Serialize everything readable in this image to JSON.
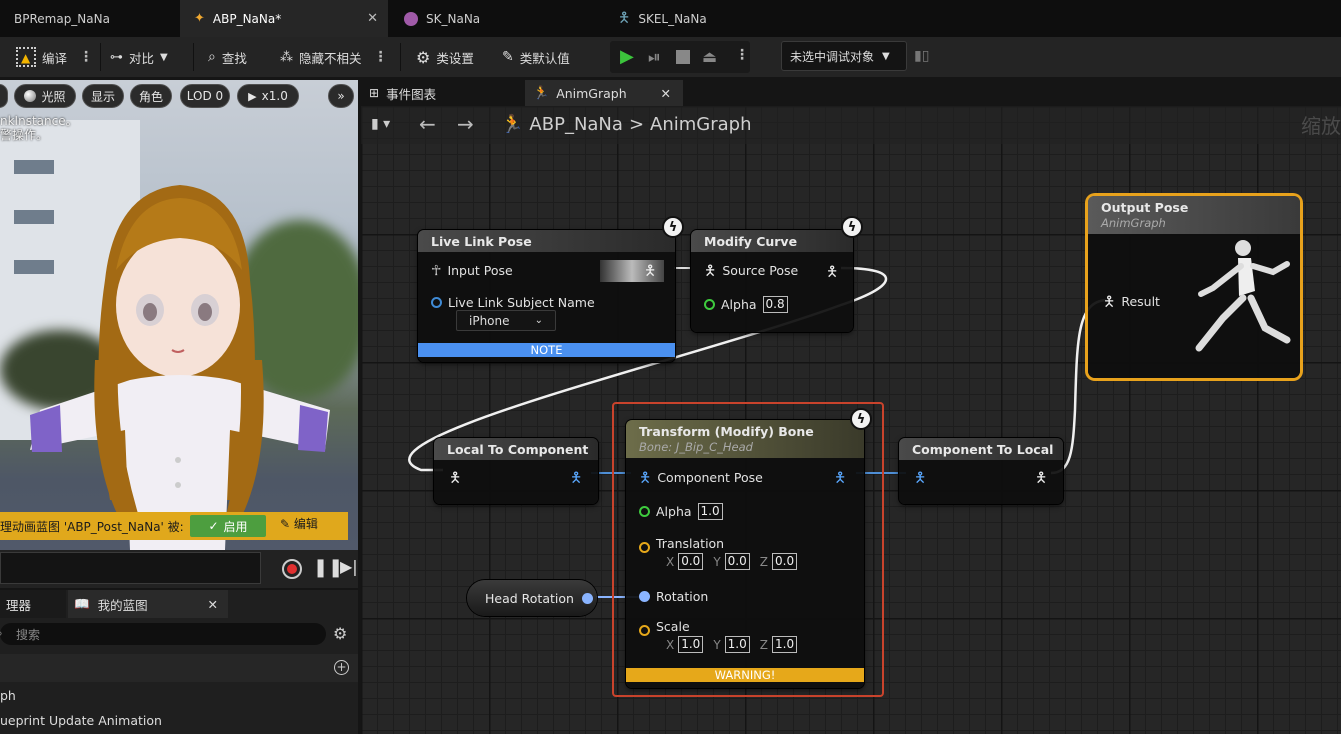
{
  "tabs": [
    {
      "label": "BPRemap_NaNa"
    },
    {
      "label": "ABP_NaNa*"
    },
    {
      "label": "SK_NaNa"
    },
    {
      "label": "SKEL_NaNa"
    }
  ],
  "toolbar": {
    "compile": "编译",
    "diff": "对比",
    "find": "查找",
    "hide_unrelated": "隐藏不相关",
    "class_settings": "类设置",
    "class_defaults": "类默认值",
    "debug_object": "未选中调试对象"
  },
  "viewport": {
    "lit": "光照",
    "show": "显示",
    "character": "角色",
    "lod": "LOD 0",
    "speed": "x1.0",
    "more": "»",
    "msg1": "nkInstance。",
    "msg2": "警操作。",
    "warning_text": "理动画蓝图 'ABP_Post_NaNa' 被:",
    "enable": "启用",
    "edit": "编辑"
  },
  "bp_panel": {
    "tab1": "理器",
    "tab2": "我的蓝图",
    "search_placeholder": "搜索",
    "row1": "ph",
    "row2": "ueprint Update Animation"
  },
  "graph": {
    "tab_event": "事件图表",
    "tab_anim": "AnimGraph",
    "crumb_root": "ABP_NaNa",
    "crumb_sep": ">",
    "crumb_leaf": "AnimGraph",
    "zoom": "缩放"
  },
  "nodes": {
    "live_link": {
      "title": "Live Link Pose",
      "input_pose": "Input Pose",
      "subject_label": "Live Link Subject Name",
      "subject_value": "iPhone",
      "note": "NOTE"
    },
    "modify_curve": {
      "title": "Modify Curve",
      "source_pose": "Source Pose",
      "alpha_label": "Alpha",
      "alpha_value": "0.8"
    },
    "output_pose": {
      "title": "Output Pose",
      "subtitle": "AnimGraph",
      "result": "Result"
    },
    "local_to_component": {
      "title": "Local To Component"
    },
    "transform_bone": {
      "title": "Transform (Modify) Bone",
      "subtitle": "Bone: J_Bip_C_Head",
      "component_pose": "Component Pose",
      "alpha_label": "Alpha",
      "alpha_value": "1.0",
      "translation": "Translation",
      "tx": "0.0",
      "ty": "0.0",
      "tz": "0.0",
      "rotation": "Rotation",
      "scale": "Scale",
      "sx": "1.0",
      "sy": "1.0",
      "sz": "1.0",
      "warning": "WARNING!",
      "x": "X",
      "y": "Y",
      "z": "Z"
    },
    "component_to_local": {
      "title": "Component To Local"
    },
    "head_rotation": {
      "title": "Head Rotation"
    }
  },
  "colors": {
    "accent_blue": "#5aa8ff",
    "warning": "#e6a81a",
    "enable_green": "#4d9e3f",
    "selected_node": "#e8a21c",
    "error_outline": "#c9432c"
  }
}
